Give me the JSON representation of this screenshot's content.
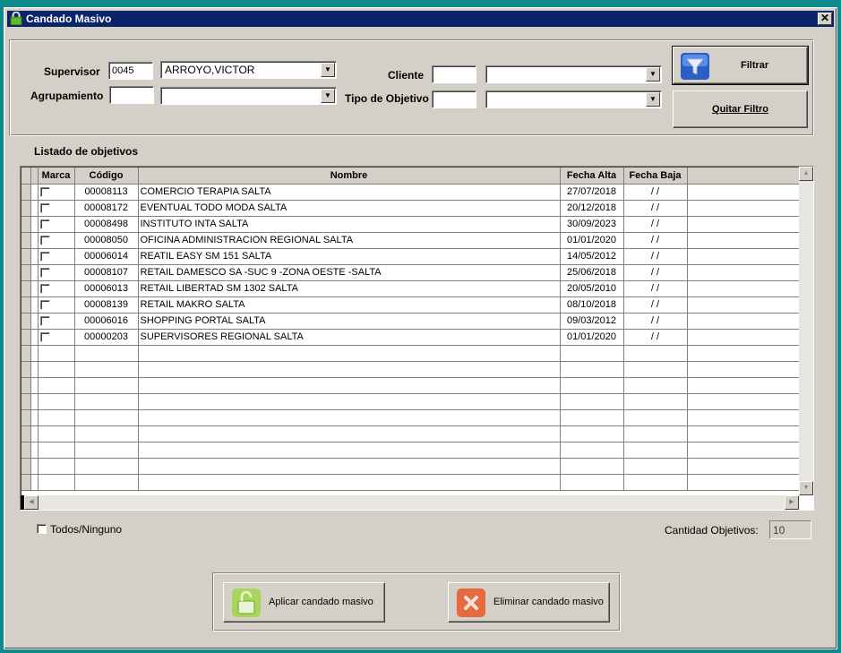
{
  "window": {
    "title": "Candado Masivo"
  },
  "filters": {
    "supervisor_label": "Supervisor",
    "supervisor_code": "0045",
    "supervisor_name": "ARROYO,VICTOR",
    "agrupamiento_label": "Agrupamiento",
    "agrupamiento_code": "",
    "agrupamiento_value": "",
    "cliente_label": "Cliente",
    "cliente_code": "",
    "cliente_value": "",
    "tipo_objetivo_label": "Tipo de Objetivo",
    "tipo_objetivo_code": "",
    "tipo_objetivo_value": "",
    "filtrar_label": "Filtrar",
    "quitar_filtro_label": "Quitar Filtro"
  },
  "list": {
    "title": "Listado de objetivos",
    "columns": [
      "Marca",
      "Código",
      "Nombre",
      "Fecha Alta",
      "Fecha Baja"
    ],
    "rows": [
      {
        "codigo": "00008113",
        "nombre": "COMERCIO TERAPIA SALTA",
        "fecha_alta": "27/07/2018",
        "fecha_baja": " / /"
      },
      {
        "codigo": "00008172",
        "nombre": "EVENTUAL TODO MODA SALTA",
        "fecha_alta": "20/12/2018",
        "fecha_baja": " / /"
      },
      {
        "codigo": "00008498",
        "nombre": "INSTITUTO INTA SALTA",
        "fecha_alta": "30/09/2023",
        "fecha_baja": " / /"
      },
      {
        "codigo": "00008050",
        "nombre": "OFICINA ADMINISTRACION REGIONAL SALTA",
        "fecha_alta": "01/01/2020",
        "fecha_baja": " / /"
      },
      {
        "codigo": "00006014",
        "nombre": "REATIL EASY SM 151 SALTA",
        "fecha_alta": "14/05/2012",
        "fecha_baja": " / /"
      },
      {
        "codigo": "00008107",
        "nombre": "RETAIL DAMESCO SA -SUC  9 -ZONA OESTE -SALTA",
        "fecha_alta": "25/06/2018",
        "fecha_baja": " / /"
      },
      {
        "codigo": "00006013",
        "nombre": "RETAIL LIBERTAD SM 1302 SALTA",
        "fecha_alta": "20/05/2010",
        "fecha_baja": " / /"
      },
      {
        "codigo": "00008139",
        "nombre": "RETAIL MAKRO SALTA",
        "fecha_alta": "08/10/2018",
        "fecha_baja": " / /"
      },
      {
        "codigo": "00006016",
        "nombre": "SHOPPING PORTAL SALTA",
        "fecha_alta": "09/03/2012",
        "fecha_baja": " / /"
      },
      {
        "codigo": "00000203",
        "nombre": "SUPERVISORES REGIONAL SALTA",
        "fecha_alta": "01/01/2020",
        "fecha_baja": " / /"
      }
    ],
    "empty_rows": 9
  },
  "footer": {
    "todos_ninguno_label": "Todos/Ninguno",
    "cantidad_label": "Cantidad Objetivos:",
    "cantidad_value": "10",
    "aplicar_label": "Aplicar candado masivo",
    "eliminar_label": "Eliminar candado masivo"
  }
}
